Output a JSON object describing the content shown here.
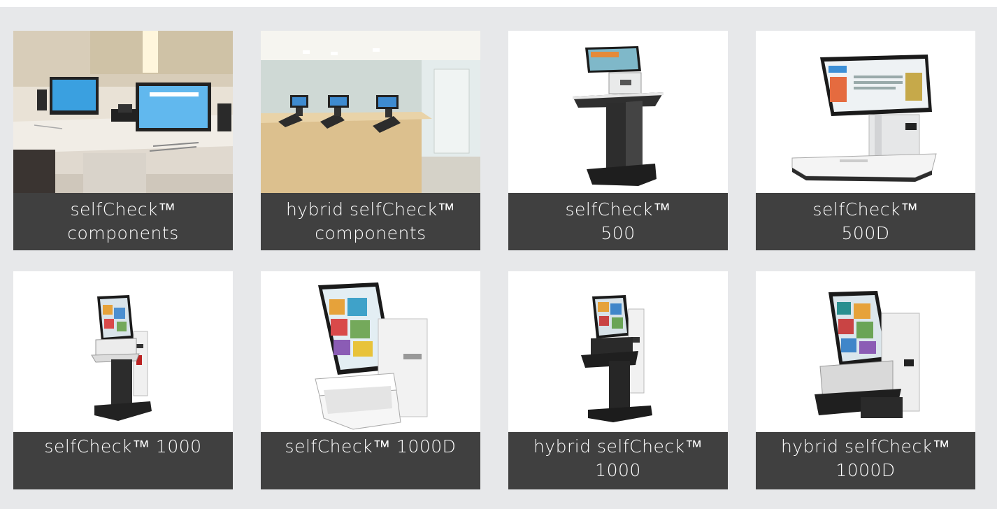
{
  "products": [
    {
      "id": "sc-components",
      "line1": "selfCheck™",
      "line2": "components"
    },
    {
      "id": "hybrid-sc-components",
      "line1": "hybrid selfCheck™",
      "line2": "components"
    },
    {
      "id": "sc-500",
      "line1": "selfCheck™",
      "line2": "500"
    },
    {
      "id": "sc-500d",
      "line1": "selfCheck™",
      "line2": "500D"
    },
    {
      "id": "sc-1000",
      "line1": "selfCheck™ 1000",
      "line2": ""
    },
    {
      "id": "sc-1000d",
      "line1": "selfCheck™ 1000D",
      "line2": ""
    },
    {
      "id": "hybrid-sc-1000",
      "line1": "hybrid selfCheck™",
      "line2": "1000"
    },
    {
      "id": "hybrid-sc-1000d",
      "line1": "hybrid selfCheck™",
      "line2": "1000D"
    }
  ],
  "colors": {
    "background": "#e7e8ea",
    "caption_bg": "#404040",
    "caption_text": "#ffffff",
    "card_bg": "#ffffff"
  }
}
